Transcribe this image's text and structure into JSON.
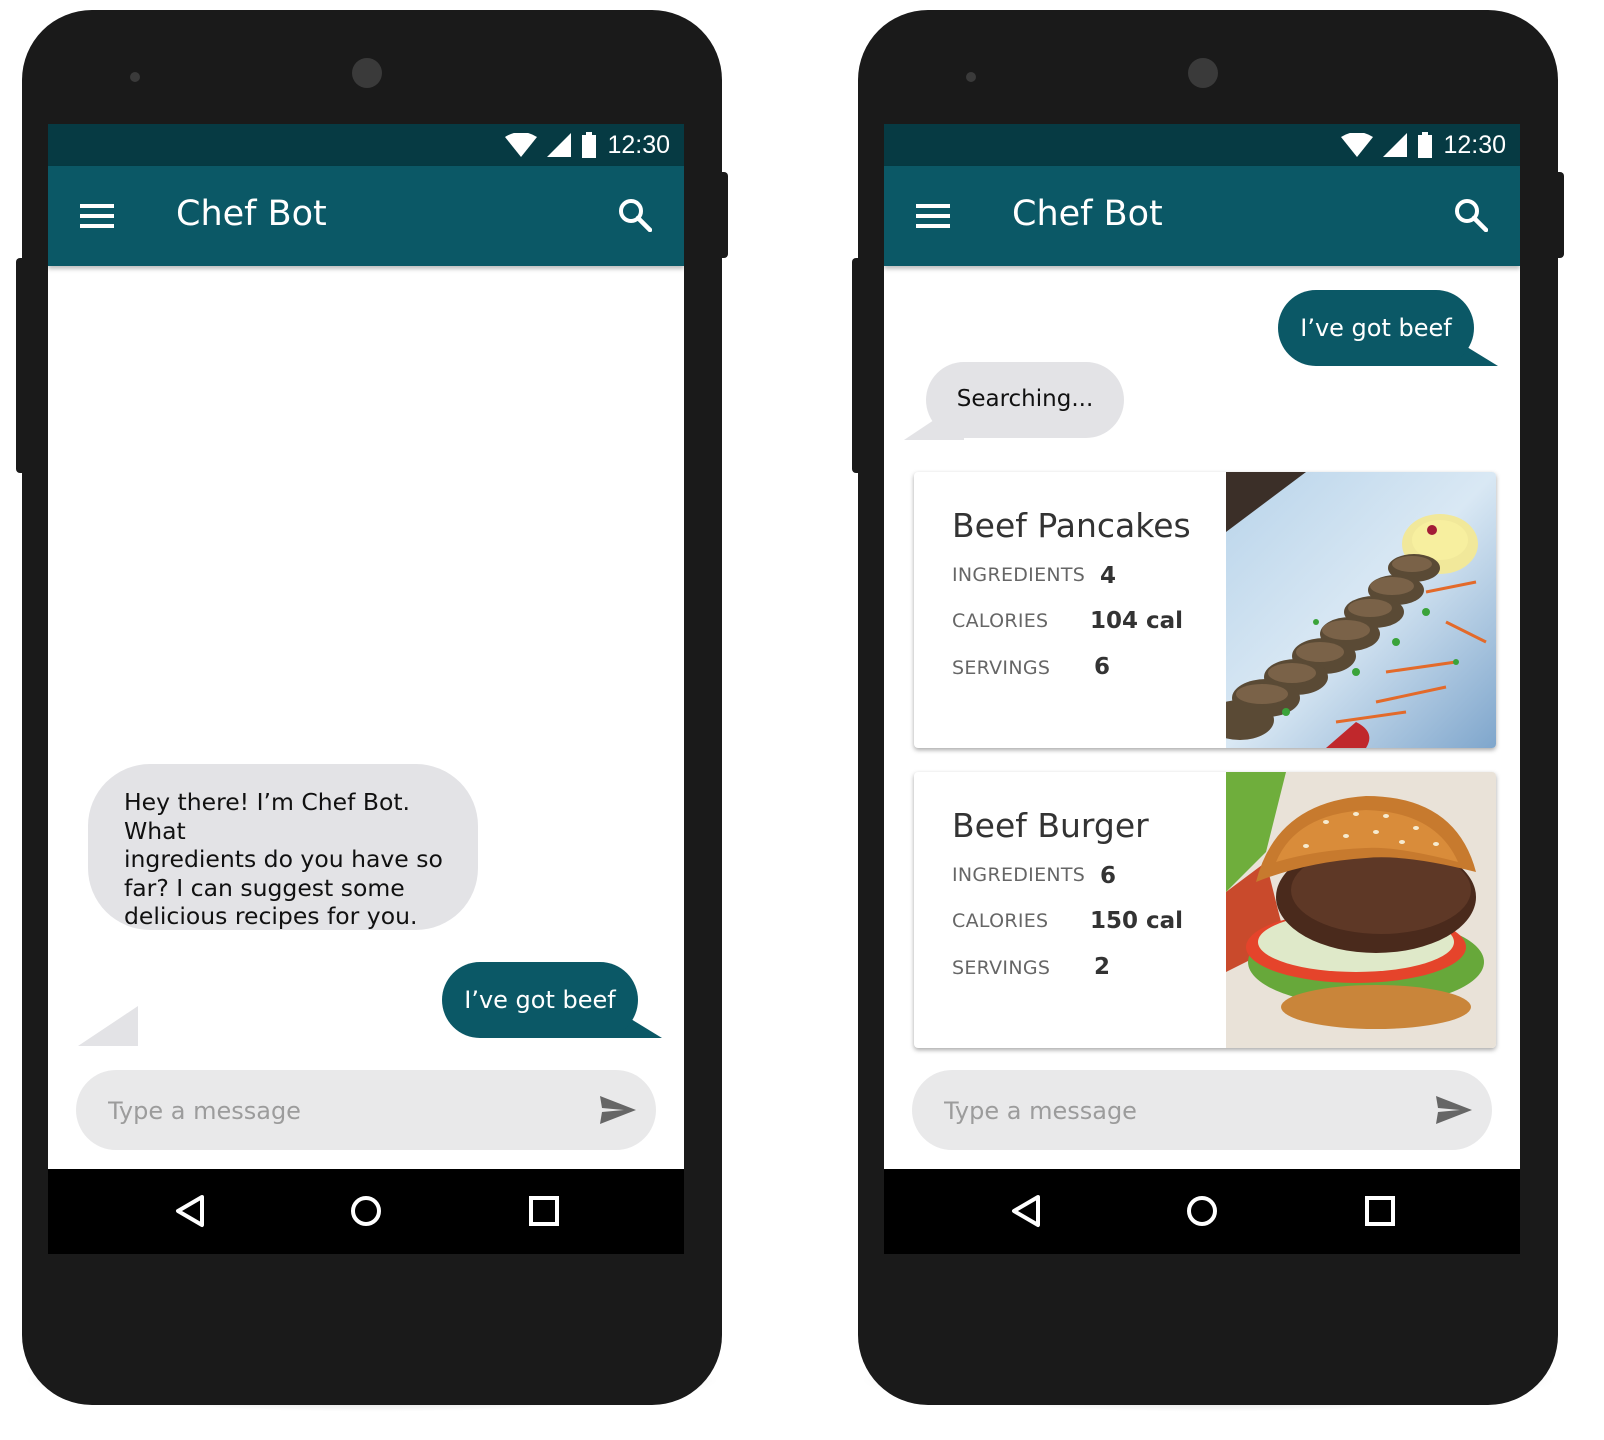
{
  "colors": {
    "status_bar": "#063a43",
    "app_bar": "#0b5866",
    "user_bubble": "#0b5866",
    "bot_bubble": "#e3e3e6",
    "phone_body": "#1a1a1a"
  },
  "phones": [
    {
      "status": {
        "time": "12:30",
        "icons": [
          "wifi-icon",
          "signal-icon",
          "battery-icon"
        ]
      },
      "appbar": {
        "title": "Chef Bot",
        "menu_icon": "menu-icon",
        "search_icon": "search-icon"
      },
      "messages": [
        {
          "from": "bot",
          "lines": [
            "Hey there! I’m Chef Bot. What",
            "ingredients do you have so",
            "far? I can suggest some",
            "delicious recipes for you."
          ]
        },
        {
          "from": "user",
          "text": "I’ve got beef"
        }
      ],
      "input": {
        "placeholder": "Type a message",
        "send_icon": "send-icon"
      },
      "nav": [
        "back-icon",
        "home-icon",
        "recents-icon"
      ]
    },
    {
      "status": {
        "time": "12:30",
        "icons": [
          "wifi-icon",
          "signal-icon",
          "battery-icon"
        ]
      },
      "appbar": {
        "title": "Chef Bot",
        "menu_icon": "menu-icon",
        "search_icon": "search-icon"
      },
      "messages": [
        {
          "from": "user",
          "text": "I’ve got beef"
        },
        {
          "from": "bot",
          "text": "Searching..."
        }
      ],
      "recipes": [
        {
          "title": "Beef Pancakes",
          "ingredients_label": "INGREDIENTS",
          "ingredients": "4",
          "calories_label": "CALORIES",
          "calories": "104 cal",
          "servings_label": "SERVINGS",
          "servings": "6",
          "image": "beef-pancakes-photo"
        },
        {
          "title": "Beef Burger",
          "ingredients_label": "INGREDIENTS",
          "ingredients": "6",
          "calories_label": "CALORIES",
          "calories": "150 cal",
          "servings_label": "SERVINGS",
          "servings": "2",
          "image": "beef-burger-photo"
        }
      ],
      "input": {
        "placeholder": "Type a message",
        "send_icon": "send-icon"
      },
      "nav": [
        "back-icon",
        "home-icon",
        "recents-icon"
      ]
    }
  ]
}
